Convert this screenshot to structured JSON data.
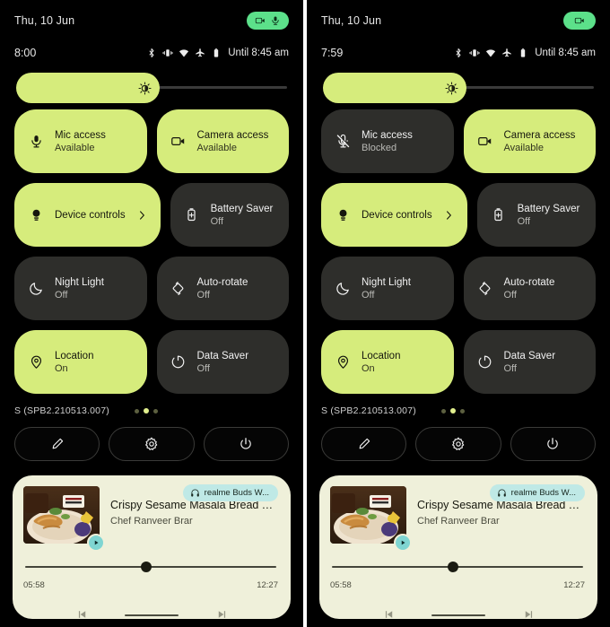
{
  "colors": {
    "screen_bg": "#000000",
    "tile_active": "#d6ec7c",
    "tile_inactive": "#2e2e2b",
    "privacy_pill": "#5ce08a",
    "media_card": "#eff0da",
    "device_chip": "#bfe9e6",
    "play_badge": "#7fd5d2"
  },
  "panels": [
    {
      "id": "left",
      "statusbar": {
        "date": "Thu, 10 Jun",
        "privacy_icons": [
          "camera-icon",
          "mic-icon"
        ]
      },
      "clockrow": {
        "clock": "8:00",
        "system_icons": [
          "bluetooth-icon",
          "vibrate-icon",
          "wifi-icon",
          "airplane-icon",
          "battery-icon"
        ],
        "battery_text": "Until 8:45 am"
      },
      "brightness": {
        "icon": "brightness-icon",
        "level_percent": 50
      },
      "tiles": [
        {
          "name": "Mic access",
          "state": "Available",
          "icon": "mic-icon",
          "active": true,
          "type": "toggle"
        },
        {
          "name": "Camera access",
          "state": "Available",
          "icon": "camera-icon",
          "active": true,
          "type": "toggle"
        },
        {
          "name": "Device controls",
          "state": "",
          "icon": "bulb-icon",
          "active": true,
          "type": "link",
          "chevron": true
        },
        {
          "name": "Battery Saver",
          "state": "Off",
          "icon": "battery-saver-icon",
          "active": false,
          "type": "toggle"
        },
        {
          "name": "Night Light",
          "state": "Off",
          "icon": "moon-icon",
          "active": false,
          "type": "toggle"
        },
        {
          "name": "Auto-rotate",
          "state": "Off",
          "icon": "auto-rotate-icon",
          "active": false,
          "type": "toggle"
        },
        {
          "name": "Location",
          "state": "On",
          "icon": "location-pin-icon",
          "active": true,
          "type": "toggle"
        },
        {
          "name": "Data Saver",
          "state": "Off",
          "icon": "data-saver-icon",
          "active": false,
          "type": "toggle"
        }
      ],
      "footer": {
        "build": "S (SPB2.210513.007)",
        "page_dots": {
          "count": 3,
          "active_index": 1
        }
      },
      "actions": [
        {
          "label": "edit",
          "icon": "pencil-icon"
        },
        {
          "label": "settings",
          "icon": "gear-icon"
        },
        {
          "label": "power",
          "icon": "power-icon"
        }
      ],
      "media": {
        "title": "Crispy Sesame Masala Bread Toas...",
        "artist": "Chef Ranveer Brar",
        "device": "realme Buds W...",
        "device_icon": "headphones-icon",
        "elapsed": "05:58",
        "duration": "12:27",
        "progress_percent": 46,
        "play_icon": "play-icon"
      }
    },
    {
      "id": "right",
      "statusbar": {
        "date": "Thu, 10 Jun",
        "privacy_icons": [
          "camera-icon"
        ]
      },
      "clockrow": {
        "clock": "7:59",
        "system_icons": [
          "bluetooth-icon",
          "vibrate-icon",
          "wifi-icon",
          "airplane-icon",
          "battery-icon"
        ],
        "battery_text": "Until 8:45 am"
      },
      "brightness": {
        "icon": "brightness-icon",
        "level_percent": 50
      },
      "tiles": [
        {
          "name": "Mic access",
          "state": "Blocked",
          "icon": "mic-off-icon",
          "active": false,
          "type": "toggle"
        },
        {
          "name": "Camera access",
          "state": "Available",
          "icon": "camera-icon",
          "active": true,
          "type": "toggle"
        },
        {
          "name": "Device controls",
          "state": "",
          "icon": "bulb-icon",
          "active": true,
          "type": "link",
          "chevron": true
        },
        {
          "name": "Battery Saver",
          "state": "Off",
          "icon": "battery-saver-icon",
          "active": false,
          "type": "toggle"
        },
        {
          "name": "Night Light",
          "state": "Off",
          "icon": "moon-icon",
          "active": false,
          "type": "toggle"
        },
        {
          "name": "Auto-rotate",
          "state": "Off",
          "icon": "auto-rotate-icon",
          "active": false,
          "type": "toggle"
        },
        {
          "name": "Location",
          "state": "On",
          "icon": "location-pin-icon",
          "active": true,
          "type": "toggle"
        },
        {
          "name": "Data Saver",
          "state": "Off",
          "icon": "data-saver-icon",
          "active": false,
          "type": "toggle"
        }
      ],
      "footer": {
        "build": "S (SPB2.210513.007)",
        "page_dots": {
          "count": 3,
          "active_index": 1
        }
      },
      "actions": [
        {
          "label": "edit",
          "icon": "pencil-icon"
        },
        {
          "label": "settings",
          "icon": "gear-icon"
        },
        {
          "label": "power",
          "icon": "power-icon"
        }
      ],
      "media": {
        "title": "Crispy Sesame Masala Bread Toas...",
        "artist": "Chef Ranveer Brar",
        "device": "realme Buds W...",
        "device_icon": "headphones-icon",
        "elapsed": "05:58",
        "duration": "12:27",
        "progress_percent": 46,
        "play_icon": "play-icon"
      }
    }
  ]
}
